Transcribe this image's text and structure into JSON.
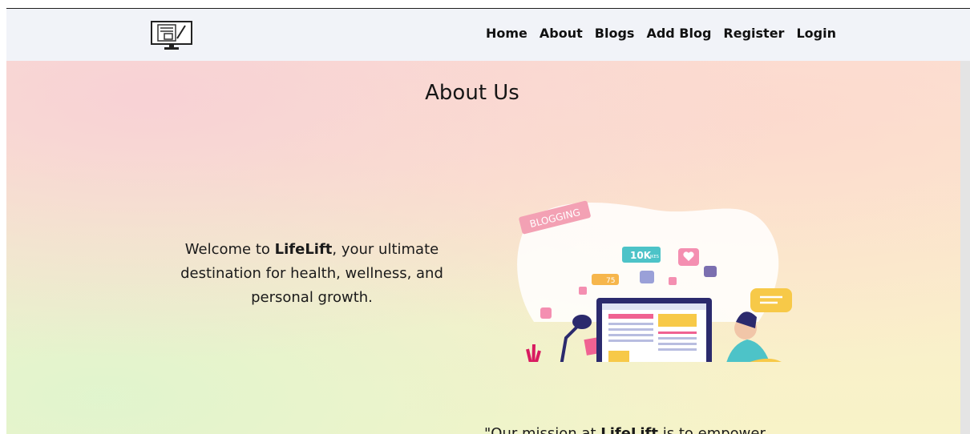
{
  "nav": {
    "links": [
      "Home",
      "About",
      "Blogs",
      "Add Blog",
      "Register",
      "Login"
    ]
  },
  "about": {
    "title": "About Us",
    "welcome_prefix": "Welcome to ",
    "welcome_brand": "LifeLift",
    "welcome_suffix": ", your ultimate destination for health, wellness, and personal growth.",
    "mission_prefix": "\"Our mission at ",
    "mission_brand": "LifeLift",
    "mission_suffix": " is to empower"
  },
  "illustration": {
    "badge_blogging": "BLOGGING",
    "badge_likes": "10K",
    "badge_likes_small": "LIKES",
    "badge_views": "75"
  },
  "colors": {
    "navbar_bg": "#f1f3f8",
    "accent_pink": "#f06292",
    "accent_teal": "#4dc3c8",
    "accent_yellow": "#f7c948",
    "monitor_navy": "#2b2a6d"
  }
}
